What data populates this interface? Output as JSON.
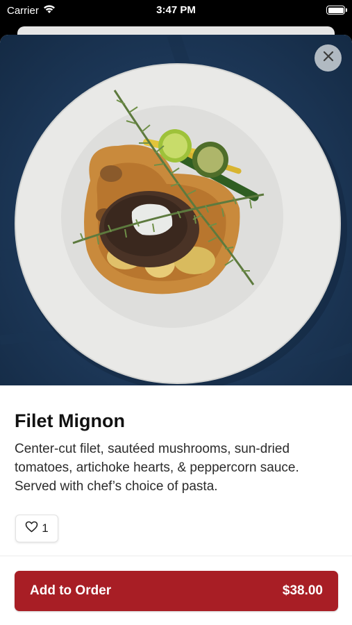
{
  "status_bar": {
    "carrier": "Carrier",
    "time": "3:47 PM"
  },
  "item": {
    "name": "Filet Mignon",
    "description": "Center-cut filet, sautéed mushrooms, sun-dried tomatoes, artichoke hearts, & peppercorn sauce. Served with chef’s choice of pasta.",
    "like_count": "1"
  },
  "order_button": {
    "label": "Add to Order",
    "price": "$38.00"
  },
  "icons": {
    "close": "close-icon",
    "heart": "heart-icon",
    "wifi": "wifi-icon",
    "battery": "battery-icon"
  },
  "colors": {
    "accent": "#a81e25",
    "background": "#ffffff",
    "status_bar": "#000000"
  }
}
